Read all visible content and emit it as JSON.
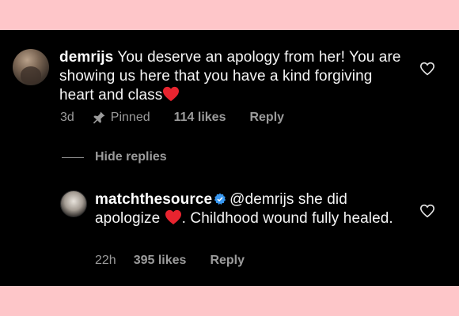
{
  "comments": [
    {
      "username": "demrijs",
      "text_before_emoji": "You deserve an apology from her! You are showing us here that you have a kind forgiving heart and class",
      "emoji": "red-heart",
      "meta": {
        "time": "3d",
        "pinned": "Pinned",
        "likes": "114 likes",
        "reply": "Reply"
      },
      "like_icon": "heart-outline-icon"
    }
  ],
  "hide_replies": "Hide replies",
  "reply": {
    "username": "matchthesource",
    "verified": true,
    "mention": "@demrijs",
    "text_part1": "she did apologize",
    "emoji": "red-heart",
    "text_part2": ". Childhood wound fully healed.",
    "meta": {
      "time": "22h",
      "likes": "395 likes",
      "reply": "Reply"
    },
    "like_icon": "heart-outline-icon"
  },
  "colors": {
    "page_background": "#fec6c9",
    "panel_background": "#000000",
    "text_primary": "#f5f5f5",
    "text_secondary": "#9b9b9b",
    "verified_blue": "#3897f0",
    "heart_red": "#e8242f"
  }
}
